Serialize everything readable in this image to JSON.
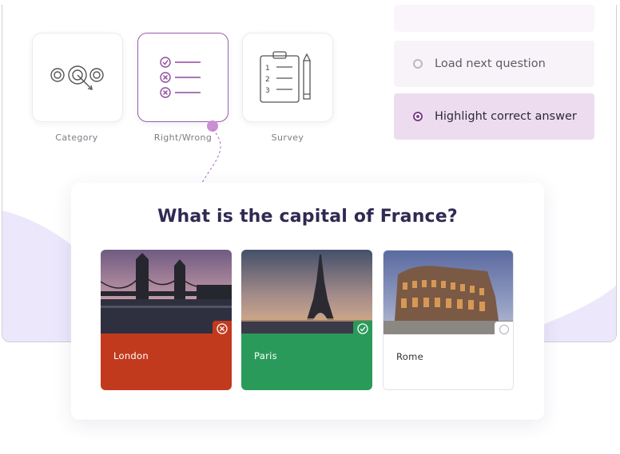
{
  "question_types": {
    "items": [
      {
        "label": "Category",
        "icon": "target-circles-icon"
      },
      {
        "label": "Right/Wrong",
        "icon": "checklist-icon"
      },
      {
        "label": "Survey",
        "icon": "clipboard-pencil-icon"
      }
    ],
    "selected": "Right/Wrong"
  },
  "feedback_options": {
    "items": [
      {
        "label": "Load next question",
        "selected": false
      },
      {
        "label": "Highlight correct answer",
        "selected": true
      }
    ]
  },
  "quiz": {
    "question": "What is the capital of France?",
    "answers": [
      {
        "city": "London",
        "state": "wrong",
        "color": "#c23a1e"
      },
      {
        "city": "Paris",
        "state": "correct",
        "color": "#2a9a5a"
      },
      {
        "city": "Rome",
        "state": "neutral",
        "color": "#ffffff"
      }
    ]
  },
  "colors": {
    "accent_purple": "#9a5ea8",
    "question_text": "#2f2a52",
    "wrong_red": "#c23a1e",
    "correct_green": "#2a9a5a",
    "highlight_bg": "#eddcf0"
  }
}
